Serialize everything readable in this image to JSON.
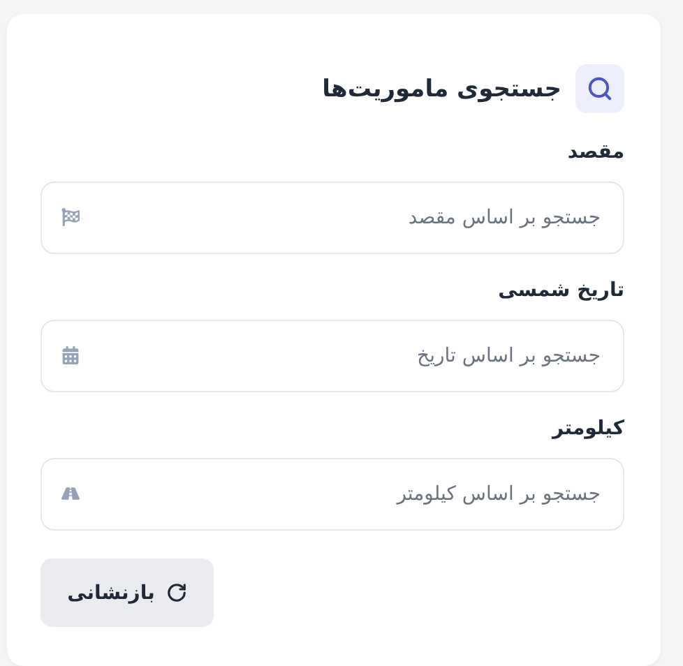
{
  "header": {
    "title": "جستجوی ماموریت‌ها"
  },
  "fields": [
    {
      "label": "مقصد",
      "placeholder": "جستجو بر اساس مقصد",
      "kind": "flag"
    },
    {
      "label": "تاریخ شمسی",
      "placeholder": "جستجو بر اساس تاریخ",
      "kind": "calendar"
    },
    {
      "label": "کیلومتر",
      "placeholder": "جستجو بر اساس کیلومتر",
      "kind": "road"
    }
  ],
  "reset_button": {
    "label": "بازنشانی"
  }
}
